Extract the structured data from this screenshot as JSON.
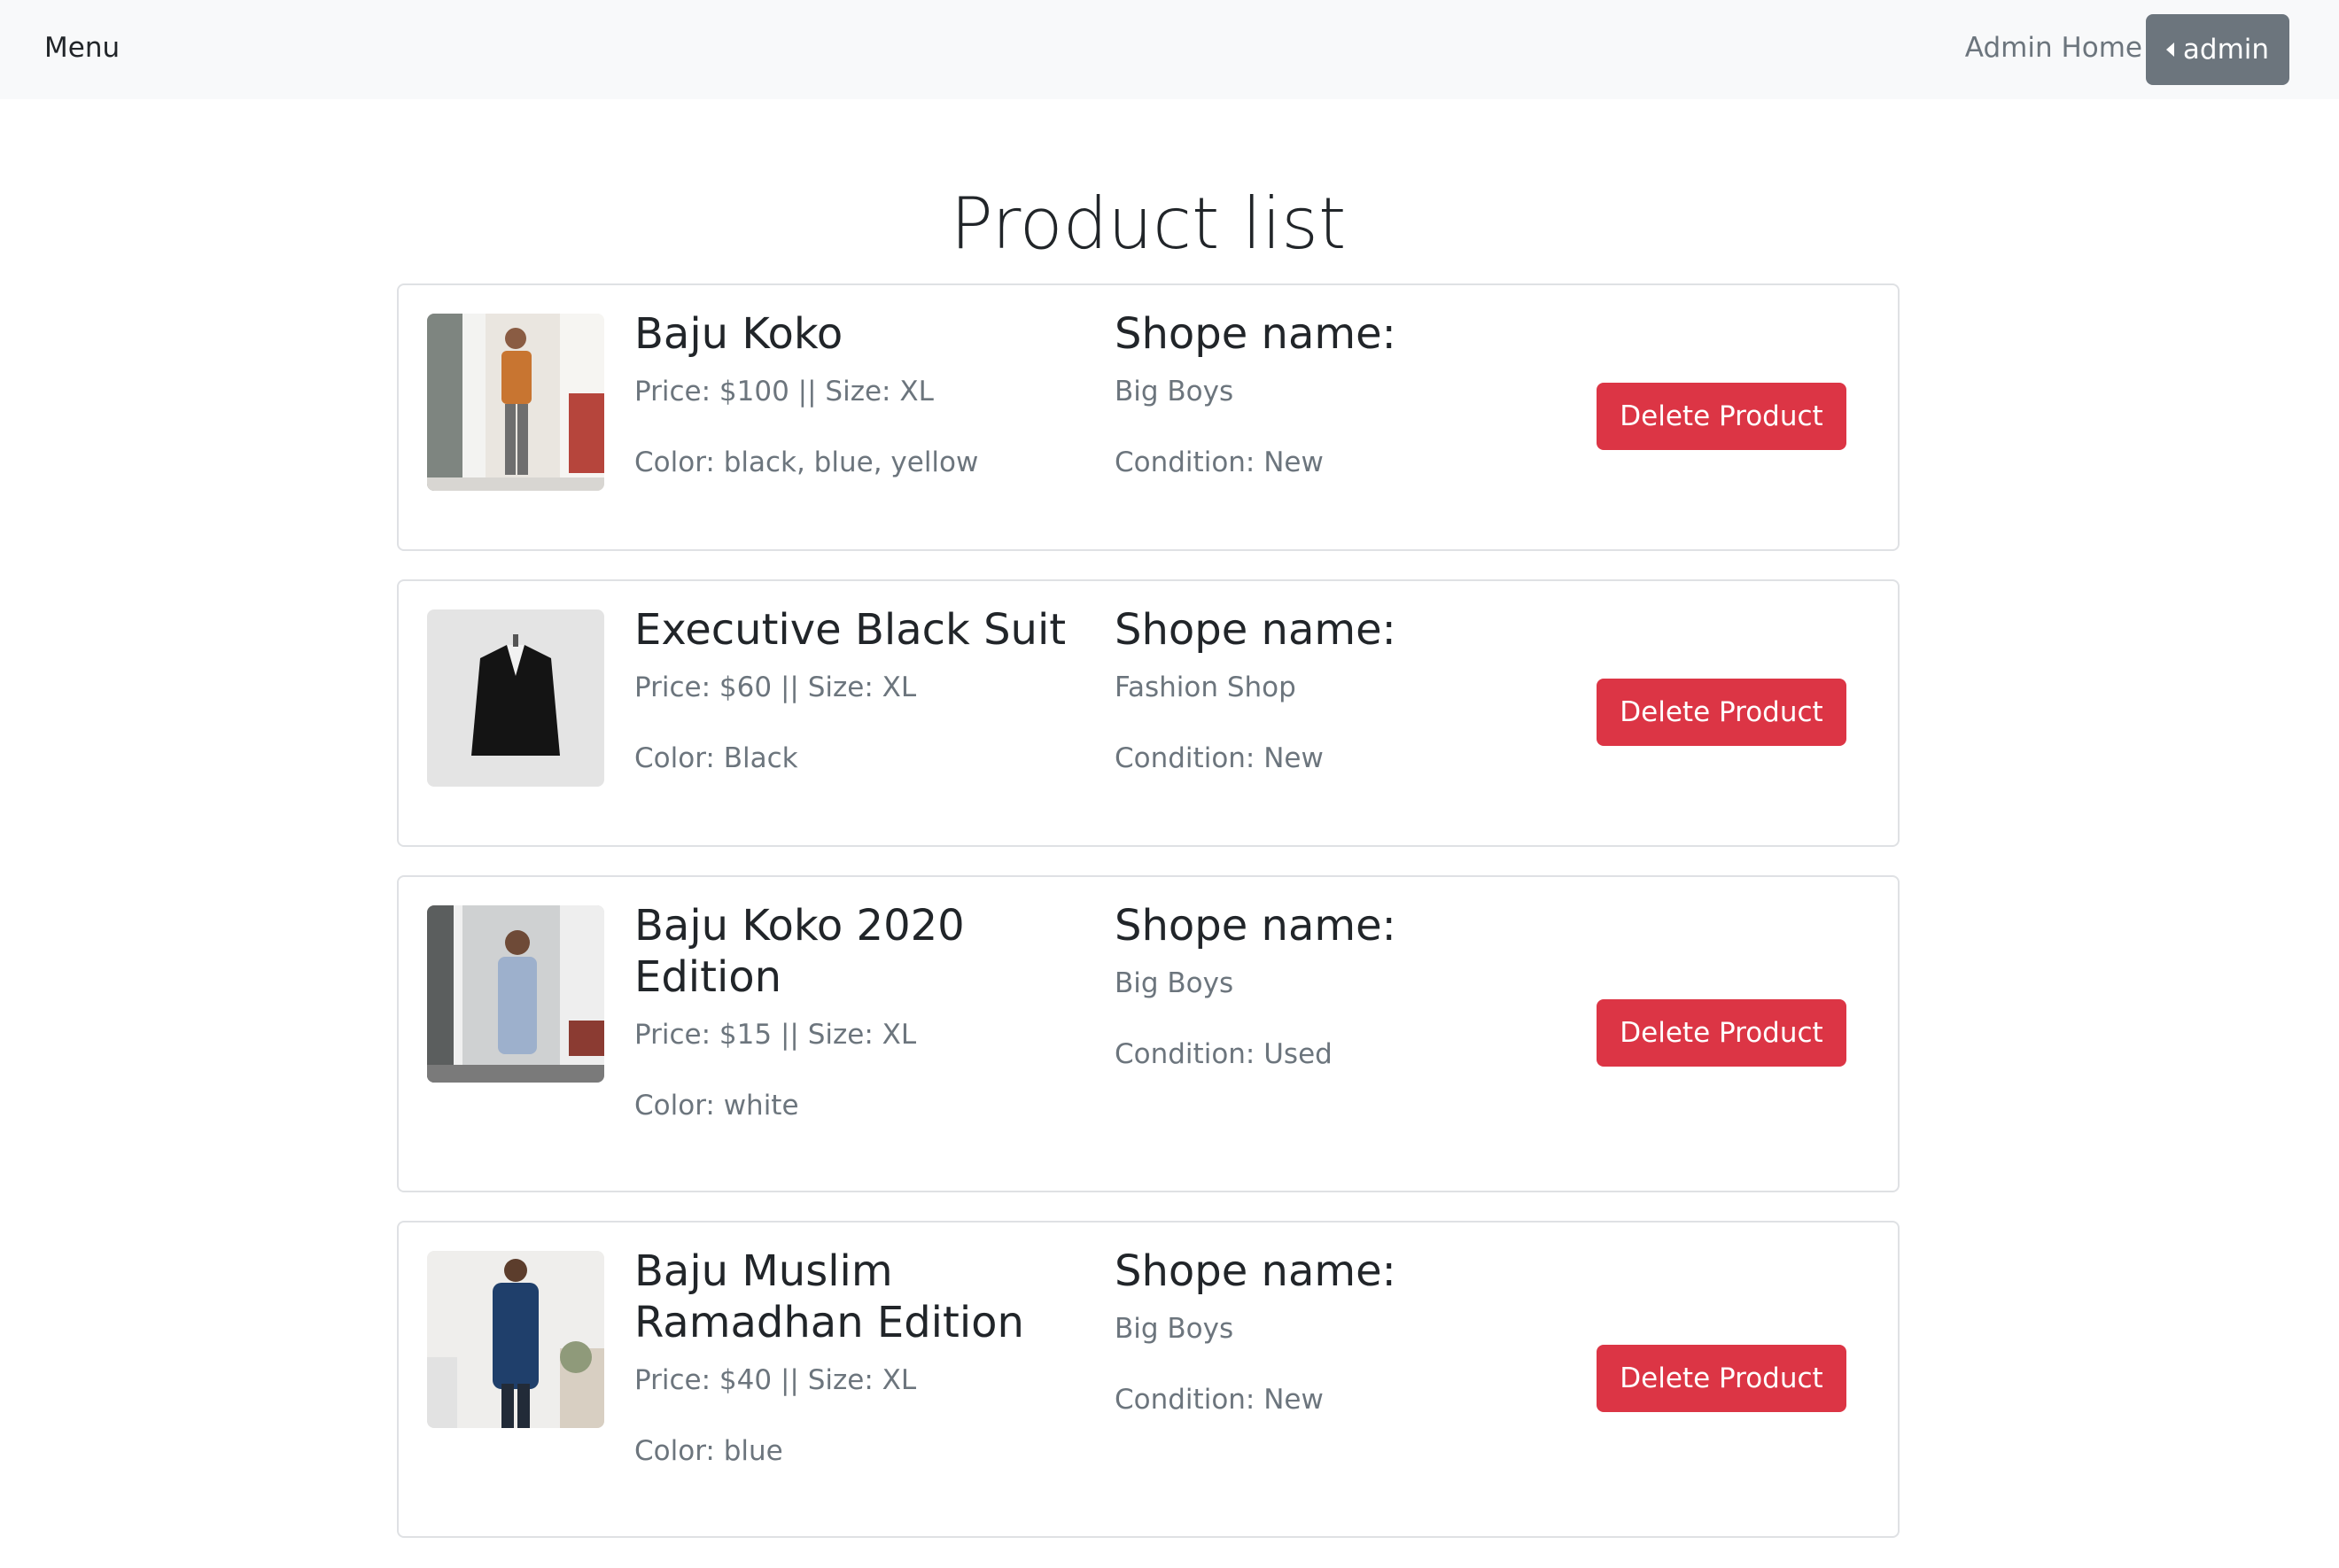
{
  "nav": {
    "menu_label": "Menu",
    "admin_home_label": "Admin Home",
    "user_label": "admin"
  },
  "page": {
    "title": "Product list"
  },
  "products": [
    {
      "name": "Baju Koko",
      "price_size": "Price: $100 || Size: XL",
      "color": "Color: black, blue, yellow",
      "shop_heading": "Shope name:",
      "shop_name": "Big Boys",
      "condition": "Condition: New",
      "delete_label": "Delete Product"
    },
    {
      "name": "Executive Black Suit",
      "price_size": "Price: $60 || Size: XL",
      "color": "Color: Black",
      "shop_heading": "Shope name:",
      "shop_name": "Fashion Shop",
      "condition": "Condition: New",
      "delete_label": "Delete Product"
    },
    {
      "name": "Baju Koko 2020 Edition",
      "price_size": "Price: $15 || Size: XL",
      "color": "Color: white",
      "shop_heading": "Shope name:",
      "shop_name": "Big Boys",
      "condition": "Condition: Used",
      "delete_label": "Delete Product"
    },
    {
      "name": "Baju Muslim Ramadhan Edition",
      "price_size": "Price: $40 || Size: XL",
      "color": "Color: blue",
      "shop_heading": "Shope name:",
      "shop_name": "Big Boys",
      "condition": "Condition: New",
      "delete_label": "Delete Product"
    }
  ],
  "colors": {
    "danger": "#dc3545",
    "secondary": "#6c757d",
    "navbar_bg": "#f8f9fa"
  }
}
